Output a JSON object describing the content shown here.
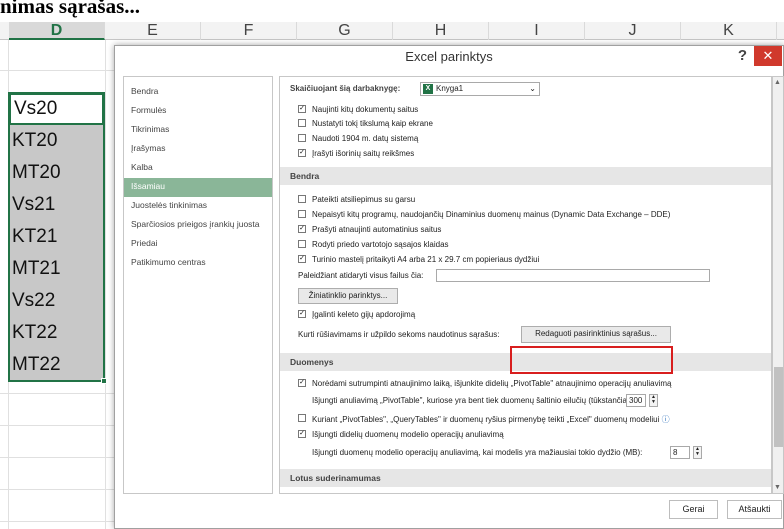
{
  "heading_fragment": "nimas sąrašas...",
  "columns": [
    "D",
    "E",
    "F",
    "G",
    "H",
    "I",
    "J",
    "K"
  ],
  "cells": [
    "Vs20",
    "KT20",
    "MT20",
    "Vs21",
    "KT21",
    "MT21",
    "Vs22",
    "KT22",
    "MT22"
  ],
  "dialog": {
    "title": "Excel parinktys",
    "help": "?",
    "close": "✕",
    "nav": [
      "Bendra",
      "Formulės",
      "Tikrinimas",
      "Įrašymas",
      "Kalba",
      "Išsamiau",
      "Juostelės tinkinimas",
      "Sparčiosios prieigos įrankių juosta",
      "Priedai",
      "Patikimumo centras"
    ],
    "active_nav_index": 5,
    "calc_label": "Skaičiuojant šią darbaknygę:",
    "calc_value": "Knyga1",
    "calc_options": [
      {
        "label": "Naujinti kitų dokumentų saitus",
        "checked": true
      },
      {
        "label": "Nustatyti tokį tikslumą kaip ekrane",
        "checked": false
      },
      {
        "label": "Naudoti 1904 m. datų sistemą",
        "checked": false
      },
      {
        "label": "Įrašyti išorinių saitų reikšmes",
        "checked": true
      }
    ],
    "general_header": "Bendra",
    "general_options": [
      {
        "label": "Pateikti atsiliepimus su garsu",
        "checked": false
      },
      {
        "label": "Nepaisyti kitų programų, naudojančių Dinaminius duomenų mainus (Dynamic Data Exchange – DDE)",
        "checked": false
      },
      {
        "label": "Prašyti atnaujinti automatinius saitus",
        "checked": true
      },
      {
        "label": "Rodyti priedo vartotojo sąsajos klaidas",
        "checked": false
      },
      {
        "label": "Turinio mastelį pritaikyti A4 arba 21 x 29.7 cm popieriaus dydžiui",
        "checked": true
      }
    ],
    "startup_label": "Paleidžiant atidaryti visus failus čia:",
    "web_options_button": "Žiniatinklio parinktys...",
    "multithread_label": "Įgalinti keleto gijų apdorojimą",
    "multithread_checked": true,
    "custom_lists_label": "Kurti rūšiavimams ir užpildo sekoms naudotinus sąrašus:",
    "custom_lists_button": "Redaguoti pasirinktinius sąrašus...",
    "data_header": "Duomenys",
    "pivot_disable_label": "Norėdami sutrumpinti atnaujinimo laiką, išjunkite didelių „PivotTable\" atnaujinimo operacijų anuliavimą",
    "pivot_disable_checked": true,
    "pivot_rows_label": "Išjungti anuliavimą „PivotTable\", kuriose yra bent tiek duomenų šaltinio eilučių (tūkstančiais):",
    "pivot_rows_value": "300",
    "data_model_label": "Kuriant „PivotTables\", „QueryTables\" ir duomenų ryšius pirmenybę teikti „Excel\" duomenų modeliui",
    "data_model_checked": false,
    "info_icon": "ⓘ",
    "undo_large_label": "Išjungti didelių duomenų modelio operacijų anuliavimą",
    "undo_large_checked": true,
    "undo_size_label": "Išjungti duomenų modelio operacijų anuliavimą, kai modelis yra mažiausiai tokio dydžio (MB):",
    "undo_size_value": "8",
    "lotus_header": "Lotus suderinamumas",
    "ok": "Gerai",
    "cancel": "Atšaukti"
  }
}
